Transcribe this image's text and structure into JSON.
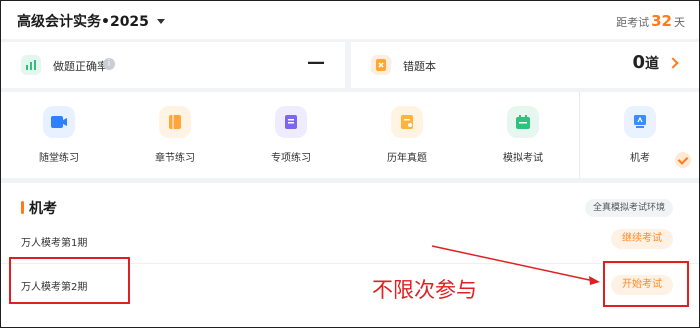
{
  "header": {
    "course_title": "高级会计实务•2025",
    "countdown_prefix": "距考试",
    "countdown_days": "32",
    "countdown_suffix": "天"
  },
  "stats": {
    "accuracy_label": "做题正确率",
    "accuracy_info_icon": "i",
    "accuracy_value": "—",
    "wrong_label": "错题本",
    "wrong_value": "0",
    "wrong_unit": "道"
  },
  "tools": [
    {
      "label": "随堂练习",
      "icon": "video-icon",
      "color": "#2f80ff",
      "tile": "#e8f1ff"
    },
    {
      "label": "章节练习",
      "icon": "book-icon",
      "color": "#ffa53a",
      "tile": "#fff3e4"
    },
    {
      "label": "专项练习",
      "icon": "document-icon",
      "color": "#7b68ee",
      "tile": "#efecff"
    },
    {
      "label": "历年真题",
      "icon": "exam-paper-icon",
      "color": "#ffb23f",
      "tile": "#fff4e2"
    },
    {
      "label": "模拟考试",
      "icon": "calendar-icon",
      "color": "#2ec27e",
      "tile": "#e5f7ee"
    },
    {
      "label": "机考",
      "icon": "computer-icon",
      "color": "#3d8bff",
      "tile": "#e9f2ff"
    }
  ],
  "section": {
    "title": "机考",
    "env_button": "全真模拟考试环境",
    "rows": [
      {
        "name": "万人模考第1期",
        "action": "继续考试"
      },
      {
        "name": "万人模考第2期",
        "action": "开始考试"
      }
    ]
  },
  "annotation": {
    "note": "不限次参与",
    "color": "#e02020"
  },
  "colors": {
    "accent": "#ff7a1a",
    "background": "#f2f3f5"
  }
}
